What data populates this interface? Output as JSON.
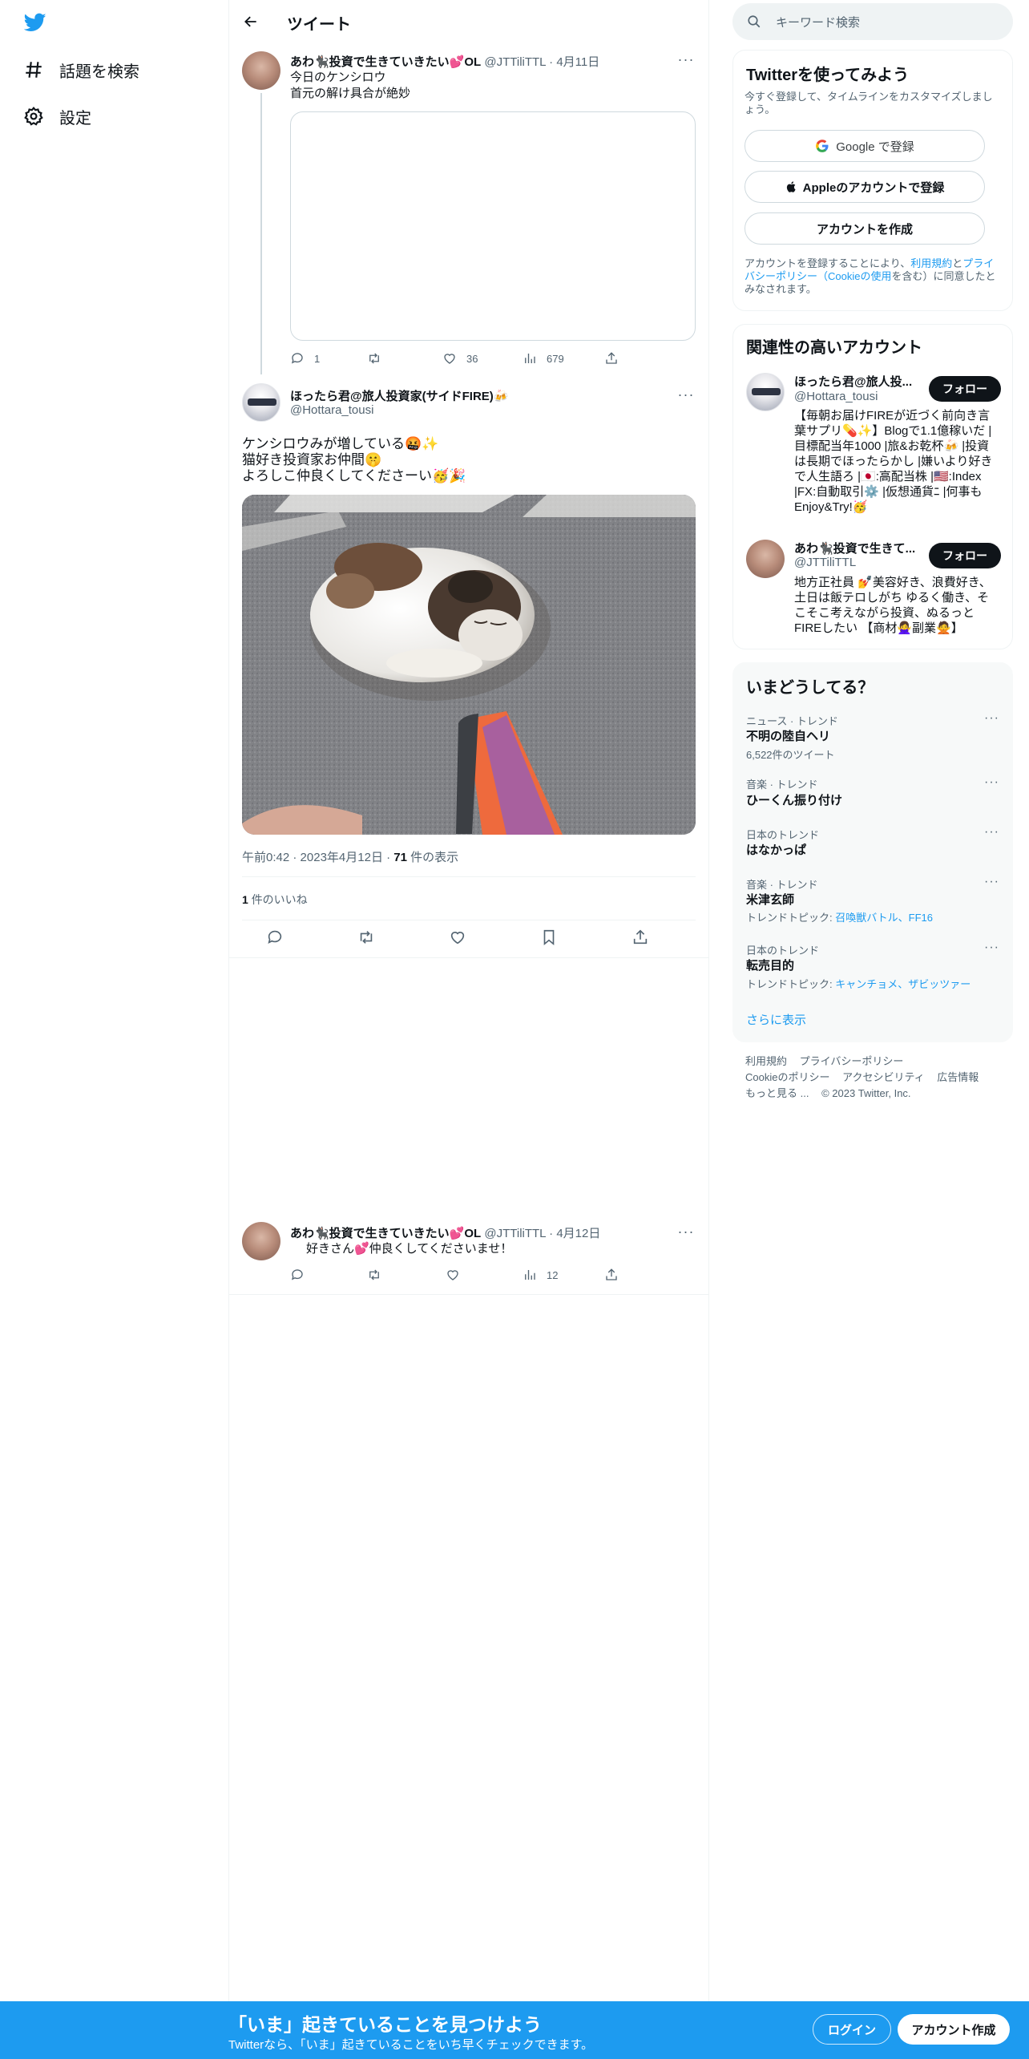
{
  "nav": {
    "explore_label": "話題を検索",
    "settings_label": "設定"
  },
  "header": {
    "title": "ツイート"
  },
  "parent_tweet": {
    "name": "あわ🐈‍⬛投資で生きていきたい💕OL",
    "handle": "@JTTiliTTL",
    "date": "4月11日",
    "text_line1": "今日のケンシロウ",
    "text_line2": "首元の解け具合が絶妙",
    "replies": "1",
    "likes": "36",
    "views": "679"
  },
  "main_tweet": {
    "name": "ほったら君@旅人投資家(サイドFIRE)🍻",
    "handle": "@Hottara_tousi",
    "text_line1": "ケンシロウみが増している🤬✨",
    "text_line2": "猫好き投資家お仲間🤫",
    "text_line3": "よろしこ仲良くしてくださーい🥳🎉",
    "time": "午前0:42",
    "date": "2023年4月12日",
    "views_count": "71",
    "views_label": "件の表示",
    "likes_count": "1",
    "likes_label": "件のいいね"
  },
  "reply_tweet": {
    "name": "あわ🐈‍⬛投資で生きていきたい💕OL",
    "handle": "@JTTiliTTL",
    "date": "4月12日",
    "text": "好きさん💕仲良くしてくださいませ！",
    "views": "12"
  },
  "search": {
    "placeholder": "キーワード検索"
  },
  "signup_card": {
    "title": "Twitterを使ってみよう",
    "subtitle": "今すぐ登録して、タイムラインをカスタマイズしましょう。",
    "google_label": "Google で登録",
    "apple_label": "Appleのアカウントで登録",
    "create_label": "アカウントを作成",
    "legal_pre": "アカウントを登録することにより、",
    "legal_terms": "利用規約",
    "legal_and": "と",
    "legal_privacy": "プライバシーポリシー（Cookieの使用",
    "legal_post": "を含む）に同意したとみなされます。"
  },
  "related": {
    "title": "関連性の高いアカウント",
    "follow_label": "フォロー",
    "accounts": [
      {
        "name": "ほったら君@旅人投...",
        "handle": "@Hottara_tousi",
        "bio": "【毎朝お届けFIREが近づく前向き言葉サプリ💊✨】Blogで1.1億稼いだ |目標配当年1000 |旅&お乾杯🍻 |投資は長期でほったらかし |嫌いより好きで人生語ろ |🇯🇵:高配当株 |🇺🇸:Index |FX:自動取引⚙️ |仮想通貨ﾆ |何事もEnjoy&Try!🥳"
      },
      {
        "name": "あわ🐈‍⬛投資で生きて...",
        "handle": "@JTTiliTTL",
        "bio": "地方正社員 💅美容好き、浪費好き、土日は飯テロしがち ゆるく働き、そこそこ考えながら投資、ぬるっとFIREしたい 【商材🙅‍♀️副業🙅】"
      }
    ]
  },
  "trends": {
    "title": "いまどうしてる？",
    "items": [
      {
        "category": "ニュース · トレンド",
        "name": "不明の陸自ヘリ",
        "sub_pre": "",
        "sub": "6,522件のツイート",
        "links": ""
      },
      {
        "category": "音楽 · トレンド",
        "name": "ひーくん振り付け",
        "sub_pre": "",
        "sub": "",
        "links": ""
      },
      {
        "category": "日本のトレンド",
        "name": "はなかっぱ",
        "sub_pre": "",
        "sub": "",
        "links": ""
      },
      {
        "category": "音楽 · トレンド",
        "name": "米津玄師",
        "sub_pre": "トレンドトピック: ",
        "sub": "",
        "links": "召喚獣バトル、FF16"
      },
      {
        "category": "日本のトレンド",
        "name": "転売目的",
        "sub_pre": "トレンドトピック: ",
        "sub": "",
        "links": "キャンチョメ、ザビッツァー"
      }
    ],
    "show_more": "さらに表示"
  },
  "footer": {
    "terms": "利用規約",
    "privacy": "プライバシーポリシー",
    "cookie": "Cookieのポリシー",
    "accessibility": "アクセシビリティ",
    "ads": "広告情報",
    "more": "もっと見る ...",
    "copyright": "© 2023 Twitter, Inc."
  },
  "banner": {
    "title": "「いま」起きていることを見つけよう",
    "subtitle": "Twitterなら、「いま」起きていることをいち早くチェックできます。",
    "login": "ログイン",
    "signup": "アカウント作成"
  },
  "colors": {
    "accent": "#1d9bf0",
    "text": "#0f1419",
    "muted": "#536471",
    "border": "#eff3f4"
  }
}
